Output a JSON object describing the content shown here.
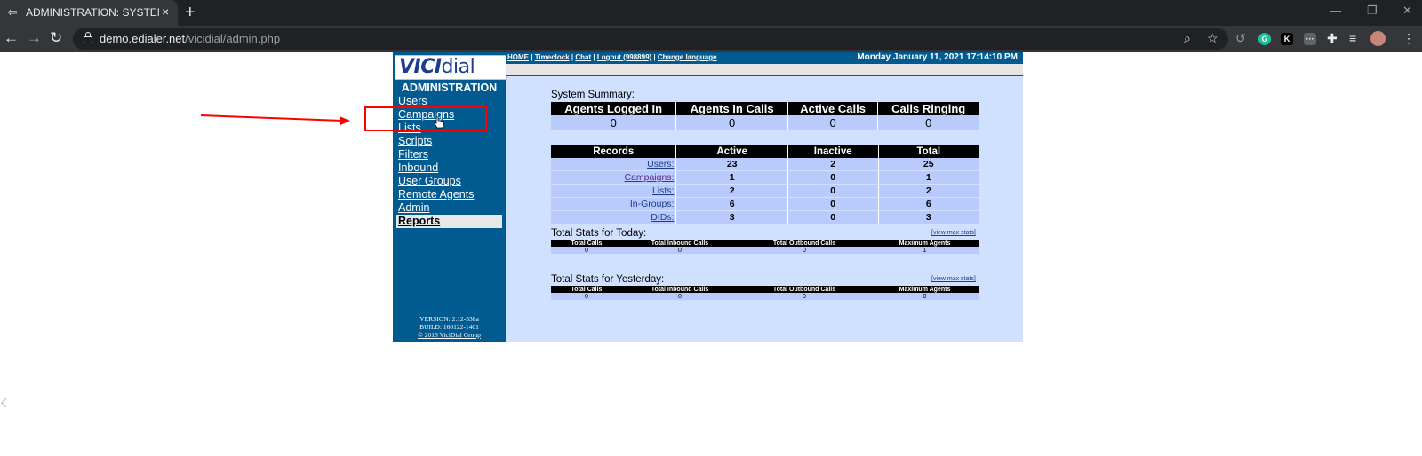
{
  "browser": {
    "tab_title": "ADMINISTRATION: SYSTEM SNAP",
    "tab_close": "×",
    "new_tab": "+",
    "url_host": "demo.edialer.net",
    "url_path": "/vicidial/admin.php",
    "window_controls": [
      "—",
      "❐",
      "✕"
    ]
  },
  "vici": {
    "logo": {
      "vici": "VICI",
      "dial": "dial"
    },
    "admin_title": "ADMINISTRATION",
    "menu": [
      "Users",
      "Campaigns",
      "Lists",
      "Scripts",
      "Filters",
      "Inbound",
      "User Groups",
      "Remote Agents",
      "Admin",
      "Reports"
    ],
    "toplinks": {
      "home": "HOME",
      "timeclock": "Timeclock",
      "chat": "Chat",
      "logout": "Logout",
      "user": "(998899)",
      "change_language": "Change language",
      "sep": " | "
    },
    "datetime": "Monday January 11, 2021 17:14:10 PM",
    "version": {
      "line1": "VERSION: 2.12-538a",
      "line2": "BUILD: 160122-1401",
      "line3": "© 2016 ViciDial Group"
    },
    "summary": {
      "title": "System Summary:",
      "headers": [
        "Agents Logged In",
        "Agents In Calls",
        "Active Calls",
        "Calls Ringing"
      ],
      "values": [
        "0",
        "0",
        "0",
        "0"
      ]
    },
    "records": {
      "headers": [
        "Records",
        "Active",
        "Inactive",
        "Total"
      ],
      "rows": [
        {
          "label": "Users:",
          "active": "23",
          "inactive": "2",
          "total": "25"
        },
        {
          "label": "Campaigns:",
          "active": "1",
          "inactive": "0",
          "total": "1"
        },
        {
          "label": "Lists:",
          "active": "2",
          "inactive": "0",
          "total": "2"
        },
        {
          "label": "In-Groups:",
          "active": "6",
          "inactive": "0",
          "total": "6"
        },
        {
          "label": "DIDs:",
          "active": "3",
          "inactive": "0",
          "total": "3"
        }
      ]
    },
    "today": {
      "title": "Total Stats for Today:",
      "link": "[view max stats]",
      "headers": [
        "Total Calls",
        "Total Inbound Calls",
        "Total Outbound Calls",
        "Maximum Agents"
      ],
      "values": [
        "0",
        "0",
        "0",
        "1"
      ]
    },
    "yesterday": {
      "title": "Total Stats for Yesterday:",
      "link": "[view max stats]",
      "headers": [
        "Total Calls",
        "Total Inbound Calls",
        "Total Outbound Calls",
        "Maximum Agents"
      ],
      "values": [
        "0",
        "0",
        "0",
        "0"
      ]
    }
  },
  "colors": {
    "vici_blue": "#015b91",
    "page_bg": "#d0e0ff",
    "cell_bg": "#b9cbfd",
    "annotation_red": "#ff0000"
  }
}
